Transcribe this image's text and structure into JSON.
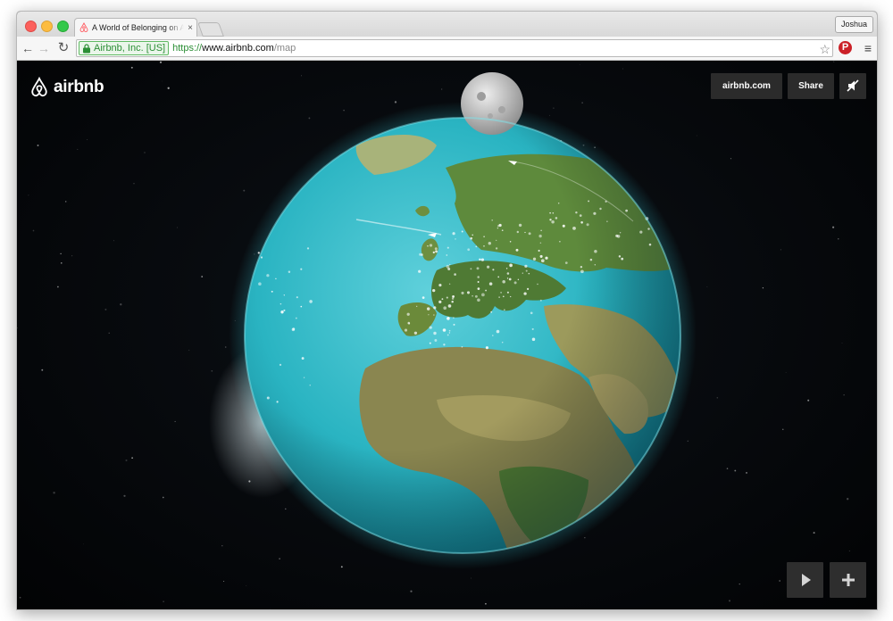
{
  "browser": {
    "tab_title": "A World of Belonging on Airbnb",
    "tab_close": "×",
    "profile_name": "Joshua",
    "ev_label": "Airbnb, Inc. [US]",
    "url_scheme": "https://",
    "url_host": "www.airbnb.com",
    "url_path": "/map",
    "nav_back": "←",
    "nav_forward": "→",
    "nav_reload": "↻",
    "star": "☆",
    "pinterest": "P",
    "menu": "≡"
  },
  "app": {
    "logo_text": "airbnb",
    "site_button": "airbnb.com",
    "share_button": "Share",
    "brand_color": "#ff5a5f",
    "icons": [
      "airbnb-logo-icon",
      "mute-icon",
      "play-icon",
      "plus-icon",
      "lock-icon",
      "star-icon",
      "pinterest-icon",
      "menu-icon"
    ]
  }
}
